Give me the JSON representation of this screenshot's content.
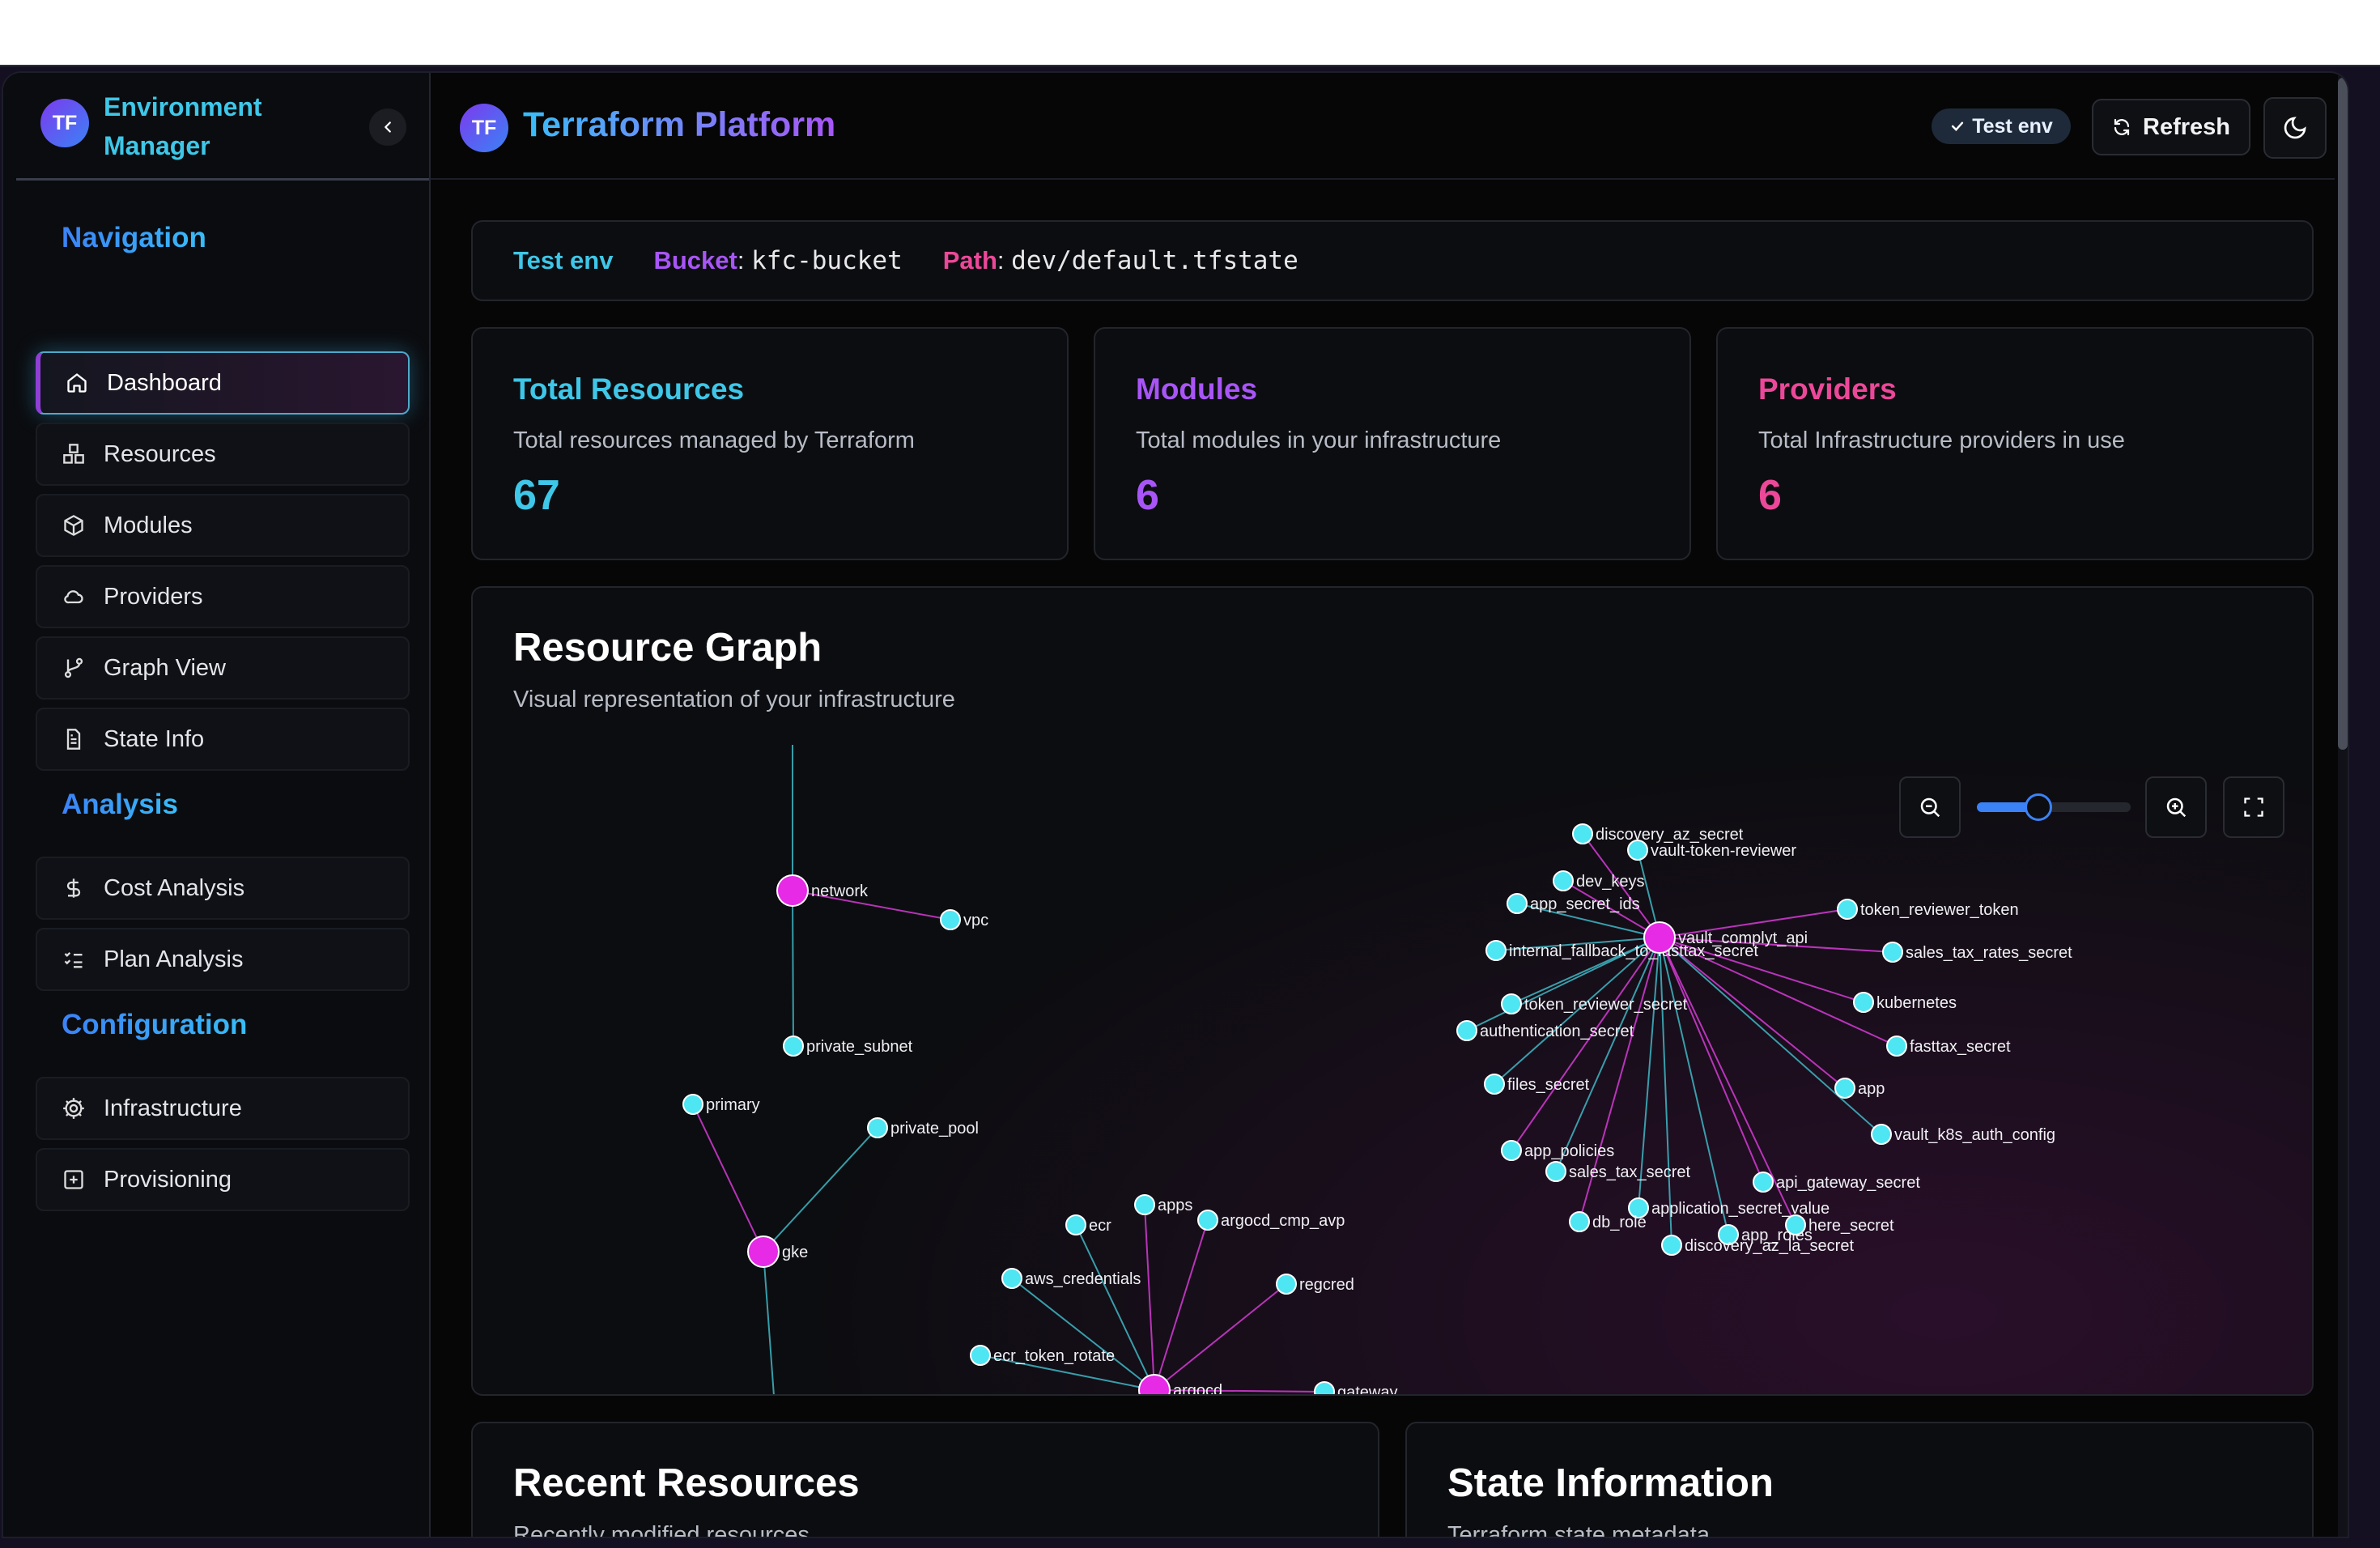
{
  "sidebar": {
    "brand_initials": "TF",
    "brand_title": "Environment Manager",
    "sections": [
      {
        "title": "Navigation"
      },
      {
        "title": "Analysis"
      },
      {
        "title": "Configuration"
      }
    ],
    "items": [
      {
        "label": "Dashboard",
        "icon": "home-icon",
        "active": true
      },
      {
        "label": "Resources",
        "icon": "boxes-icon"
      },
      {
        "label": "Modules",
        "icon": "package-icon"
      },
      {
        "label": "Providers",
        "icon": "cloud-icon"
      },
      {
        "label": "Graph View",
        "icon": "git-branch-icon"
      },
      {
        "label": "State Info",
        "icon": "file-text-icon"
      },
      {
        "label": "Cost Analysis",
        "icon": "dollar-icon"
      },
      {
        "label": "Plan Analysis",
        "icon": "list-checks-icon"
      },
      {
        "label": "Infrastructure",
        "icon": "cog-icon"
      },
      {
        "label": "Provisioning",
        "icon": "plus-square-icon"
      }
    ]
  },
  "header": {
    "initials": "TF",
    "title": "Terraform Platform",
    "env_badge": "Test env",
    "refresh_label": "Refresh"
  },
  "info_bar": {
    "env": "Test env",
    "bucket_label": "Bucket",
    "bucket": "kfc-bucket",
    "path_label": "Path",
    "path": "dev/default.tfstate"
  },
  "stats": [
    {
      "title": "Total Resources",
      "description": "Total resources managed by Terraform",
      "value": "67",
      "color": "#3ec7e8"
    },
    {
      "title": "Modules",
      "description": "Total modules in your infrastructure",
      "value": "6",
      "color": "#a855f7"
    },
    {
      "title": "Providers",
      "description": "Total Infrastructure providers in use",
      "value": "6",
      "color": "#ec4899"
    }
  ],
  "graph": {
    "title": "Resource Graph",
    "description": "Visual representation of your infrastructure",
    "zoom_level": 0.4,
    "colors": {
      "hub": "#e62ae6",
      "leaf": "#4ee6f2"
    },
    "hubs": [
      "network",
      "gke",
      "argocd",
      "vault_complyt_api"
    ],
    "leaves": {
      "network": [
        "vpc",
        "private_subnet"
      ],
      "gke": [
        "primary",
        "private_pool"
      ],
      "argocd": [
        "apps",
        "ecr",
        "argocd_cmp_avp",
        "aws_credentials",
        "regcred",
        "ecr_token_rotate",
        "gateway"
      ],
      "vault_complyt_api": [
        "discovery_az_secret",
        "vault-token-reviewer",
        "dev_keys",
        "app_secret_ids",
        "token_reviewer_token",
        "internal_fallback_to_fasttax_secret",
        "sales_tax_rates_secret",
        "token_reviewer_secret",
        "kubernetes",
        "authentication_secret",
        "fasttax_secret",
        "files_secret",
        "app",
        "vault_k8s_auth_config",
        "app_policies",
        "sales_tax_secret",
        "api_gateway_secret",
        "application_secret_value",
        "db_role",
        "app_roles",
        "here_secret",
        "discovery_az_la_secret"
      ]
    },
    "edge_colors": [
      "#d63bd6",
      "#3fb7c4"
    ]
  },
  "recent": {
    "title": "Recent Resources",
    "description": "Recently modified resources"
  },
  "state": {
    "title": "State Information",
    "description": "Terraform state metadata"
  }
}
